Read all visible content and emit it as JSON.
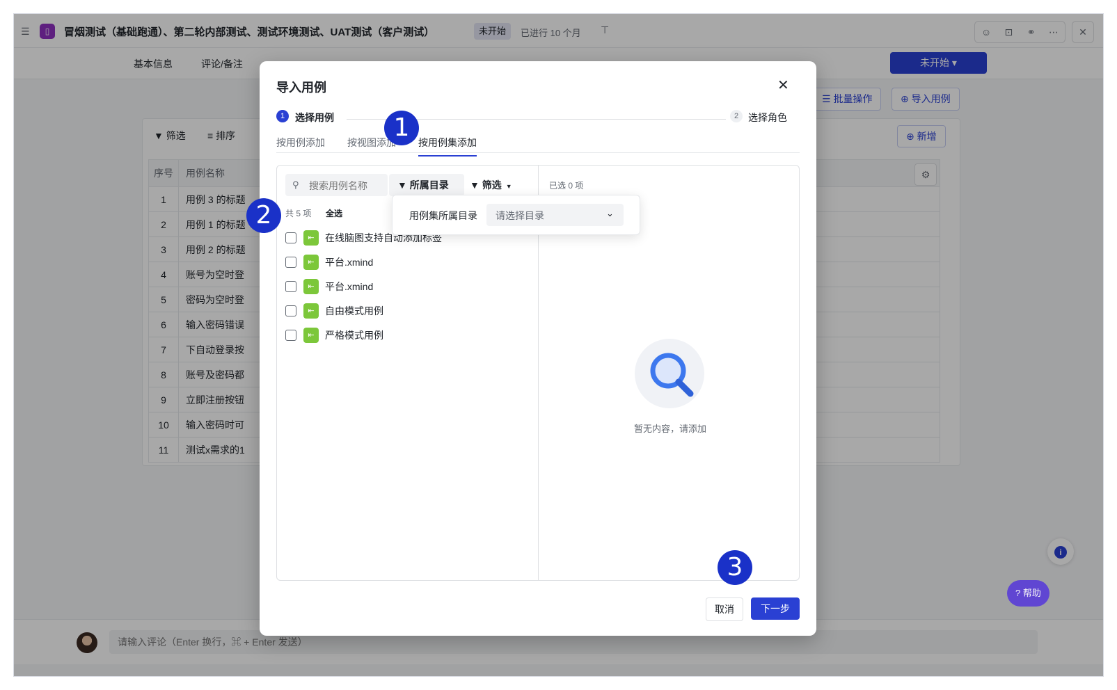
{
  "window": {
    "title": "冒烟测试（基础跑通）、第二轮内部测试、测试环境测试、UAT测试（客户测试）",
    "status_pill": "未开始",
    "duration": "已进行 10 个月",
    "toolbar_icons": [
      "people-icon",
      "bookmark-icon",
      "link-icon",
      "more-icon"
    ],
    "close_glyph": "✕"
  },
  "nav": {
    "tabs": [
      "基本信息",
      "评论/备注"
    ],
    "status_button": "未开始 ▾"
  },
  "actions": {
    "bulk": "批量操作",
    "import": "导入用例"
  },
  "panel": {
    "filter": "筛选",
    "sort": "排序",
    "add": "新增",
    "columns": [
      "序号",
      "用例名称"
    ],
    "rows": [
      {
        "idx": "1",
        "name": "用例 3 的标题"
      },
      {
        "idx": "2",
        "name": "用例 1 的标题"
      },
      {
        "idx": "3",
        "name": "用例 2 的标题"
      },
      {
        "idx": "4",
        "name": "账号为空时登"
      },
      {
        "idx": "5",
        "name": "密码为空时登"
      },
      {
        "idx": "6",
        "name": "输入密码错误"
      },
      {
        "idx": "7",
        "name": "下自动登录按"
      },
      {
        "idx": "8",
        "name": "账号及密码都"
      },
      {
        "idx": "9",
        "name": "立即注册按钮"
      },
      {
        "idx": "10",
        "name": "输入密码时可"
      },
      {
        "idx": "11",
        "name": "测试x需求的1"
      }
    ]
  },
  "comment": {
    "placeholder": "请输入评论（Enter 换行，⌘ + Enter 发送）"
  },
  "help": "帮助",
  "modal": {
    "title": "导入用例",
    "step1": {
      "num": "1",
      "label": "选择用例"
    },
    "step2": {
      "num": "2",
      "label": "选择角色"
    },
    "subtabs": [
      "按用例添加",
      "按视图添加",
      "按用例集添加"
    ],
    "search_placeholder": "搜索用例名称",
    "dir_filter": "所属目录",
    "filter": "筛选",
    "count": "共 5 项",
    "select_all": "全选",
    "selected": "已选 0 项",
    "items": [
      "在线脑图支持自动添加标签",
      "平台.xmind",
      "平台.xmind",
      "自由模式用例",
      "严格模式用例"
    ],
    "dropdown_label": "用例集所属目录",
    "dropdown_placeholder": "请选择目录",
    "empty_text": "暂无内容，请添加",
    "cancel": "取消",
    "next": "下一步"
  },
  "markers": [
    "1",
    "2",
    "3"
  ],
  "colors": {
    "accent": "#2a40d3",
    "marker": "#1a31c8",
    "case_icon": "#7cc73a",
    "app_badge": "#8f2fc1"
  }
}
